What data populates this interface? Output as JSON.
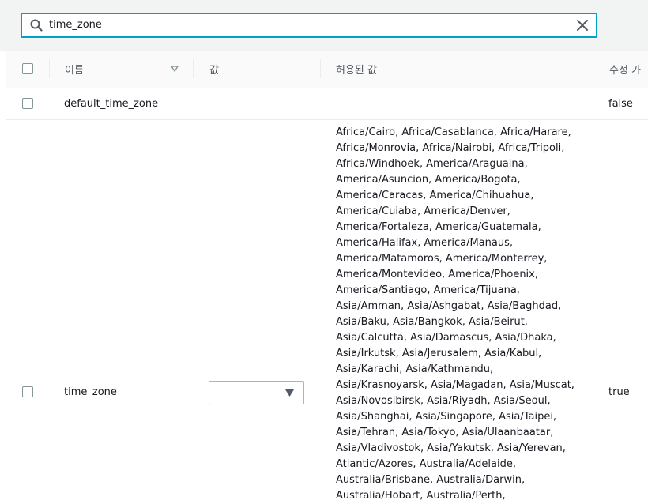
{
  "search": {
    "value": "time_zone",
    "placeholder": ""
  },
  "table": {
    "columns": {
      "name": "이름",
      "value": "값",
      "allowed": "허용된 값",
      "modifiable": "수정 가"
    },
    "rows": [
      {
        "name": "default_time_zone",
        "value": "",
        "allowed": [],
        "modifiable": "false"
      },
      {
        "name": "time_zone",
        "value": "",
        "allowed": [
          "Africa/Cairo, Africa/Casablanca, Africa/Harare,",
          "Africa/Monrovia, Africa/Nairobi, Africa/Tripoli,",
          "Africa/Windhoek, America/Araguaina,",
          "America/Asuncion, America/Bogota,",
          "America/Caracas, America/Chihuahua,",
          "America/Cuiaba, America/Denver,",
          "America/Fortaleza, America/Guatemala,",
          "America/Halifax, America/Manaus,",
          "America/Matamoros, America/Monterrey,",
          "America/Montevideo, America/Phoenix,",
          "America/Santiago, America/Tijuana,",
          "Asia/Amman, Asia/Ashgabat, Asia/Baghdad,",
          "Asia/Baku, Asia/Bangkok, Asia/Beirut,",
          "Asia/Calcutta, Asia/Damascus, Asia/Dhaka,",
          "Asia/Irkutsk, Asia/Jerusalem, Asia/Kabul,",
          "Asia/Karachi, Asia/Kathmandu,",
          "Asia/Krasnoyarsk, Asia/Magadan, Asia/Muscat,",
          "Asia/Novosibirsk, Asia/Riyadh, Asia/Seoul,",
          "Asia/Shanghai, Asia/Singapore, Asia/Taipei,",
          "Asia/Tehran, Asia/Tokyo, Asia/Ulaanbaatar,",
          "Asia/Vladivostok, Asia/Yakutsk, Asia/Yerevan,",
          "Atlantic/Azores, Australia/Adelaide,",
          "Australia/Brisbane, Australia/Darwin,",
          "Australia/Hobart, Australia/Perth,"
        ],
        "modifiable": "true"
      }
    ]
  },
  "icons": {
    "search": "search-icon",
    "clear": "close-icon",
    "sort": "sort-down-icon",
    "dropdown": "caret-down-icon"
  },
  "colors": {
    "focus_border": "#00a1c9",
    "background_band": "#f2f3f3",
    "header_text": "#545b64"
  }
}
